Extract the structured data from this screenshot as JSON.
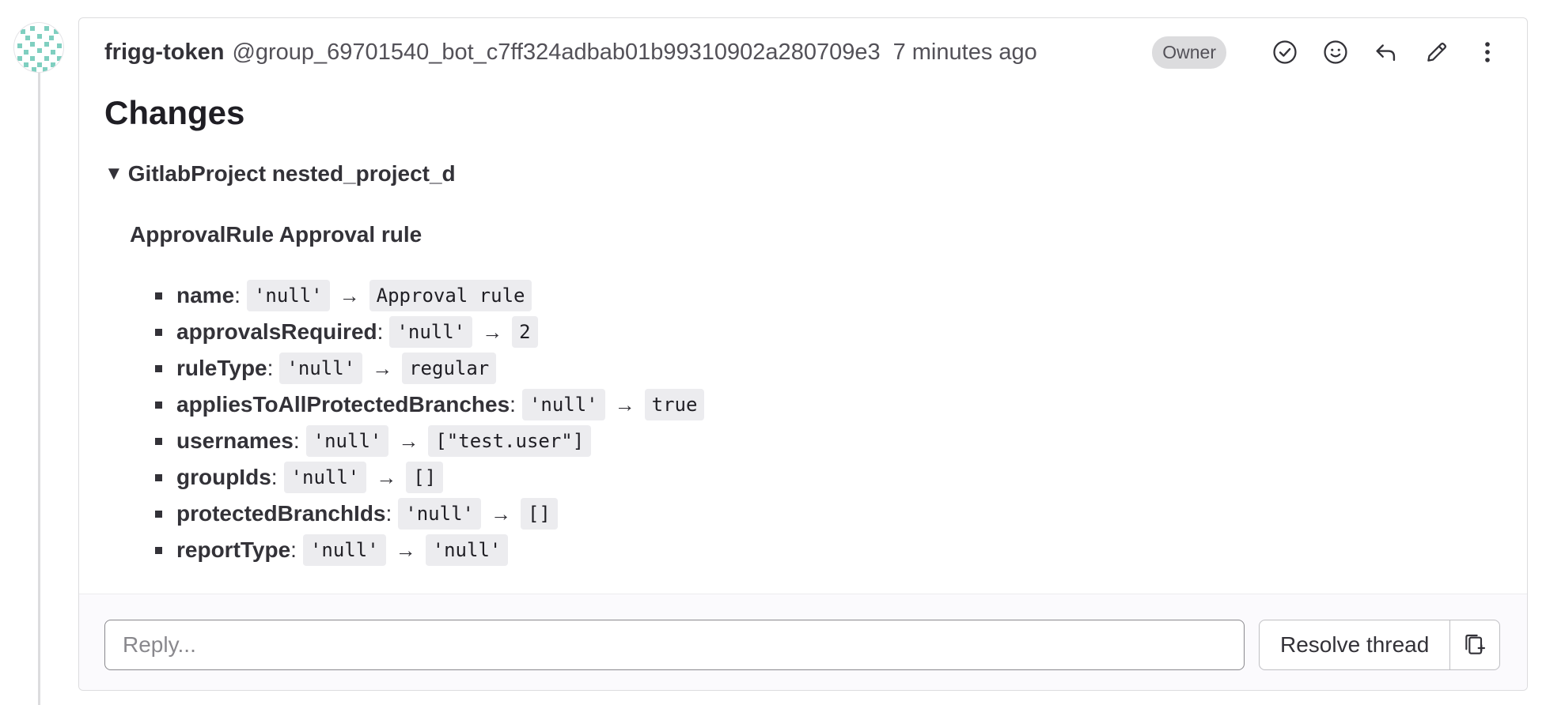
{
  "note": {
    "author_name": "frigg-token",
    "author_handle": "@group_69701540_bot_c7ff324adbab01b99310902a280709e3",
    "time_ago": "7 minutes ago",
    "role_badge": "Owner",
    "title": "Changes"
  },
  "header_actions": [
    {
      "name": "resolve-icon"
    },
    {
      "name": "emoji-icon"
    },
    {
      "name": "reply-icon"
    },
    {
      "name": "edit-icon"
    },
    {
      "name": "more-actions-icon"
    }
  ],
  "project": {
    "caret": "▼",
    "label": "GitlabProject nested_project_d"
  },
  "rule_heading": "ApprovalRule Approval rule",
  "arrow": "→",
  "changes": [
    {
      "field": "name",
      "from": "'null'",
      "to": "Approval rule"
    },
    {
      "field": "approvalsRequired",
      "from": "'null'",
      "to": "2"
    },
    {
      "field": "ruleType",
      "from": "'null'",
      "to": "regular"
    },
    {
      "field": "appliesToAllProtectedBranches",
      "from": "'null'",
      "to": "true"
    },
    {
      "field": "usernames",
      "from": "'null'",
      "to": "[\"test.user\"]"
    },
    {
      "field": "groupIds",
      "from": "'null'",
      "to": "[]"
    },
    {
      "field": "protectedBranchIds",
      "from": "'null'",
      "to": "[]"
    },
    {
      "field": "reportType",
      "from": "'null'",
      "to": "'null'"
    }
  ],
  "reply": {
    "placeholder": "Reply...",
    "resolve_label": "Resolve thread"
  },
  "colors": {
    "avatar_accent": "#7fcfc0",
    "border": "#dcdcde",
    "code_bg": "#ececef"
  }
}
